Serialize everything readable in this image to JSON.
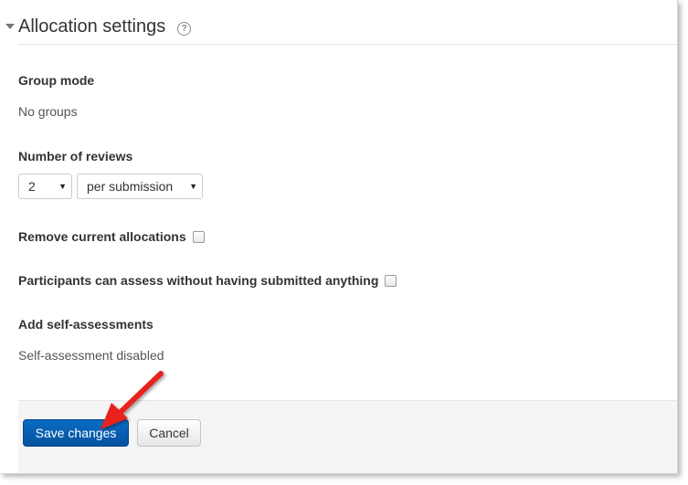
{
  "section": {
    "title": "Allocation settings",
    "help_icon": "help-icon"
  },
  "group_mode": {
    "label": "Group mode",
    "value": "No groups"
  },
  "number_of_reviews": {
    "label": "Number of reviews",
    "count_selected": "2",
    "per_selected": "per submission"
  },
  "remove_current": {
    "label": "Remove current allocations",
    "checked": false
  },
  "participants_assess": {
    "label": "Participants can assess without having submitted anything",
    "checked": false
  },
  "self_assessments": {
    "label": "Add self-assessments",
    "value": "Self-assessment disabled"
  },
  "buttons": {
    "save": "Save changes",
    "cancel": "Cancel"
  },
  "colors": {
    "primary": "#0a6cc2",
    "annotation_arrow": "#e8201c",
    "footer_bg": "#f5f5f5"
  }
}
